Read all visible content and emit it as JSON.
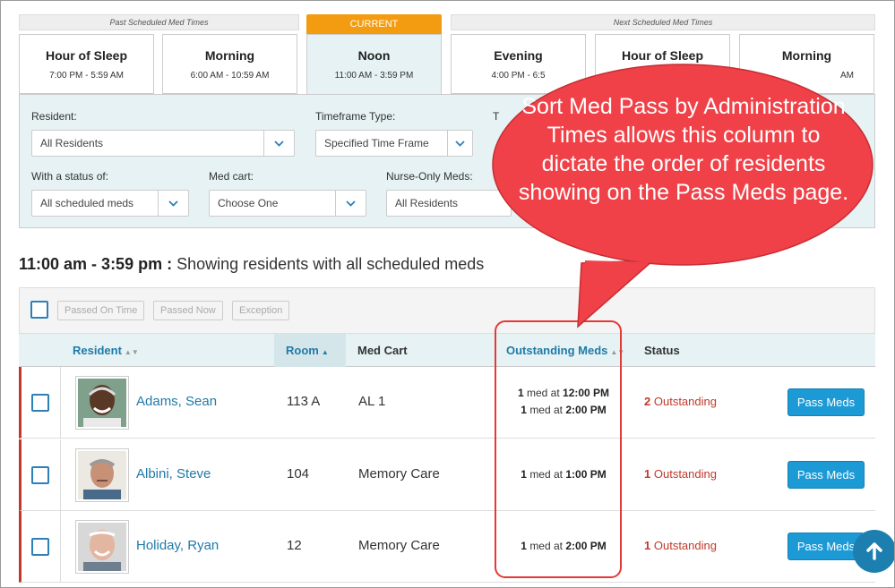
{
  "tabs": {
    "past_label": "Past Scheduled Med Times",
    "current_label": "CURRENT",
    "next_label": "Next Scheduled Med Times",
    "slots": [
      {
        "name": "Hour of Sleep",
        "time": "7:00 PM - 5:59 AM"
      },
      {
        "name": "Morning",
        "time": "6:00 AM - 10:59 AM"
      },
      {
        "name": "Noon",
        "time": "11:00 AM - 3:59 PM"
      },
      {
        "name": "Evening",
        "time": "4:00 PM - 6:5"
      },
      {
        "name": "Hour of Sleep",
        "time": ""
      },
      {
        "name": "Morning",
        "time": "AM"
      }
    ]
  },
  "filters": {
    "resident_label": "Resident:",
    "resident_value": "All Residents",
    "timeframe_label": "Timeframe Type:",
    "timeframe_value": "Specified Time Frame",
    "t_label": "T",
    "status_label": "With a status of:",
    "status_value": "All scheduled meds",
    "medcart_label": "Med cart:",
    "medcart_value": "Choose One",
    "nurse_label": "Nurse-Only Meds:",
    "nurse_value": "All Residents"
  },
  "heading": {
    "range": "11:00 am - 3:59 pm :",
    "desc": "Showing residents with all scheduled meds"
  },
  "toolbar": {
    "passed_on_time": "Passed On Time",
    "passed_now": "Passed Now",
    "exception": "Exception"
  },
  "columns": {
    "resident": "Resident",
    "room": "Room",
    "med_cart": "Med Cart",
    "outstanding": "Outstanding Meds",
    "status": "Status"
  },
  "rows": [
    {
      "name": "Adams, Sean",
      "room": "113 A",
      "cart": "AL 1",
      "meds": [
        {
          "count": "1",
          "mid": "med at",
          "time": "12:00 PM"
        },
        {
          "count": "1",
          "mid": "med at",
          "time": "2:00 PM"
        }
      ],
      "status_count": "2",
      "status_text": "Outstanding",
      "action": "Pass Meds"
    },
    {
      "name": "Albini, Steve",
      "room": "104",
      "cart": "Memory Care",
      "meds": [
        {
          "count": "1",
          "mid": "med at",
          "time": "1:00 PM"
        }
      ],
      "status_count": "1",
      "status_text": "Outstanding",
      "action": "Pass Meds"
    },
    {
      "name": "Holiday, Ryan",
      "room": "12",
      "cart": "Memory Care",
      "meds": [
        {
          "count": "1",
          "mid": "med at",
          "time": "2:00 PM"
        }
      ],
      "status_count": "1",
      "status_text": "Outstanding",
      "action": "Pass Meds"
    }
  ],
  "callout": {
    "text": "Sort Med Pass by Administration Times allows this column to dictate the order of residents showing on the Pass Meds page.",
    "color": "#f04148"
  },
  "colors": {
    "accent": "#1c9ad6",
    "current_tab": "#f39c12",
    "panel": "#e6f2f4",
    "outstanding": "#c0392b"
  },
  "icons": {
    "caret": "chevron-down-icon",
    "sort": "sort-icon",
    "scroll_top": "arrow-up-icon"
  }
}
